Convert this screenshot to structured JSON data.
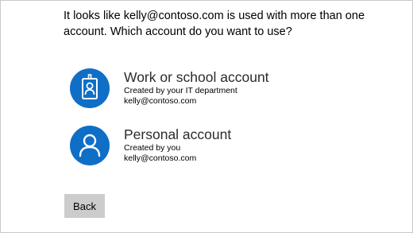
{
  "prompt": {
    "line1": "It looks like kelly@contoso.com is used with more than one",
    "line2": "account. Which account do you want to use?"
  },
  "accounts": [
    {
      "title": "Work or school account",
      "subtitle": "Created by your IT department",
      "email": "kelly@contoso.com",
      "icon": "id-badge-icon"
    },
    {
      "title": "Personal account",
      "subtitle": "Created by you",
      "email": "kelly@contoso.com",
      "icon": "person-icon"
    }
  ],
  "buttons": {
    "back": "Back"
  },
  "colors": {
    "accent": "#0f6fc6",
    "button_bg": "#cccccc"
  }
}
